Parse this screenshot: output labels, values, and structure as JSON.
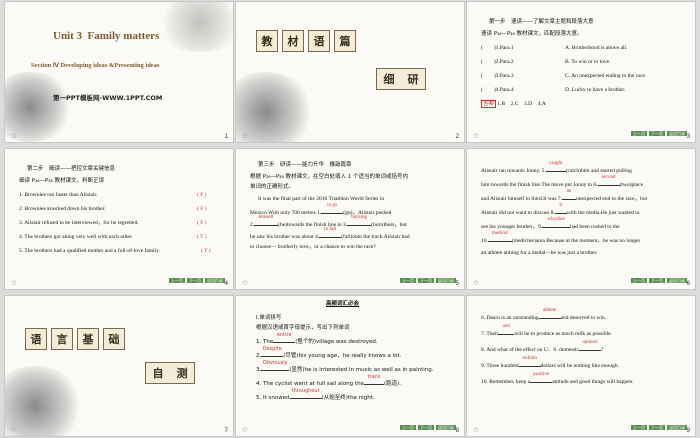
{
  "s1": {
    "unit": "Unit 3",
    "title": "Family matters",
    "section": "Section Ⅳ Developing ideas &Presenting ideas",
    "site": "第一PPT模板网-WWW.1PPT.COM",
    "num": "1"
  },
  "s2": {
    "tiles": [
      "教",
      "材",
      "语",
      "篇"
    ],
    "sub": [
      "细",
      "研"
    ],
    "num": "2"
  },
  "s3": {
    "step": "第一步　速读——了解文章主题和段落大意",
    "instr": "速读 P₂₆—P₂₈ 教材课文，匹配段落大意。",
    "rows": [
      {
        "p": "(　　)1.Para.1",
        "o": "A.  Brotherhood is above all."
      },
      {
        "p": "(　　)2.Para.2",
        "o": "B.  To win or to love."
      },
      {
        "p": "(　　)3.Para.3",
        "o": "C.  An unexpected ending to the race."
      },
      {
        "p": "(　　)4.Para.4",
        "o": "D.  Lucky to have a brother."
      }
    ],
    "ans_tag": "答案",
    "ans": "1.B　2.C　3.D　4.A",
    "num": "3"
  },
  "s4": {
    "step": "第二步　细读——把控文章关键信息",
    "instr": "细读 P₂₆—P₂₈ 教材课文，判断正误",
    "items": [
      {
        "t": "1.  Browniee ran faster than Alistair.",
        "a": "( F )"
      },
      {
        "t": "2.  Browniee knocked down his brother.",
        "a": "( F )"
      },
      {
        "t": "3.  Alistair refused to be interviewed，for he regretted.",
        "a": "( F )"
      },
      {
        "t": "4.  The brothers got along very well with each other.",
        "a": "( T )"
      },
      {
        "t": "5.  The brothers had a qualified mother and a full-of-love family.",
        "a": "( T )"
      }
    ],
    "num": "4"
  },
  "s5": {
    "step": "第三步　研读——能力升华　推敲篇章",
    "l1": "根据 P₂₆—P₂₈ 教材课文，在空白处填入 1 个适当的单词或括号内",
    "l2": "单词的正确形式。",
    "l3": "It was the final part of the 2016 Triathlon World Series in",
    "l4a": "Mexico.With only 700 metres 1.",
    "b1": "to go",
    "l4b": "(go)，Alistair pushed",
    "l5a": "2.",
    "b2": "himself",
    "l5b": "(he)towards the finish line in 3.",
    "b3": "burning",
    "l5c": "(burn)heat，but",
    "l6a": "he saw his brother was about 4.",
    "b4": "to fall",
    "l6b": "(fall)onto the track.Alistair had",
    "l7": "to choose— brotherly love，or a chance to win the race?",
    "num": "5"
  },
  "s6": {
    "l1a": "Alistair ran towards Jonny, 5.",
    "b5": "caught",
    "l1b": "(catch)him and started pulling",
    "l2a": "him towards the finish line.The move put Jonny in 6.",
    "b6": "second",
    "l2b": "(two)place",
    "l3a": "and Alistair himself in third.It was 7.",
    "b7": "an",
    "l3b": "unexpected end to the race，but",
    "l4a": "Alistair did not want to discuss 8.",
    "b8": "it",
    "l4b": "with the media.He just wanted to",
    "l5a": "see his younger brother，9.",
    "b9": "who/that",
    "l5b": "had been rushed to the",
    "l6a": "10.",
    "b10": "medical",
    "l6b": "(medicine)area.Because at the moment，he was no longer",
    "l7": "an athlete aiming for a medal—he was just a brother.",
    "num": "6"
  },
  "s7": {
    "tiles": [
      "语",
      "言",
      "基",
      "础"
    ],
    "sub": [
      "自",
      "测"
    ],
    "num": "7"
  },
  "s8": {
    "header": "高频词汇必会",
    "sec": "Ⅰ.单词拼写",
    "instr": "根据汉语或首字母提示，写出下列单词",
    "r1a": "1.  The",
    "b1": "entire",
    "r1b": "(整个的)village was destroyed.",
    "r2a": "2.",
    "b2": "Despite",
    "r2b": "(尽管)his young age，he really knows a lot.",
    "r3a": "3.",
    "b3": "Obviously",
    "r3b": "(显然)he is interested in music as well as in painting.",
    "r4a": "4.  The cyclist went at full sail along the",
    "b4": "track",
    "r4b": "(跑道).",
    "r5a": "5.  It snowed",
    "b5": "throughout",
    "r5b": "(从始至终)the night.",
    "num": "8"
  },
  "s9": {
    "r6a": "6.  Dearu is an outstanding",
    "b6": "athlete",
    "r6b": "and deserved to win.",
    "r7a": "7.  Their",
    "b7": "aim",
    "r7b": "will be to produce as much milk as possible.",
    "r8a": "8.  And what of the effect on U．S. domestic",
    "b8": "opinion",
    "r8b": "?",
    "r9a": "9.  Three hundred",
    "b9": "million",
    "r9b": "dollars will be nothing like enough.",
    "r10a": "10.  Remember, keep a",
    "b10": "positive",
    "r10b": "attitude and good things will happen.",
    "num": "9"
  },
  "btn_labels": [
    "上一页",
    "下一页",
    "返回目录"
  ],
  "star": "✩",
  "colors": {
    "accent": "#3e8f63",
    "answer": "#c0392b"
  }
}
